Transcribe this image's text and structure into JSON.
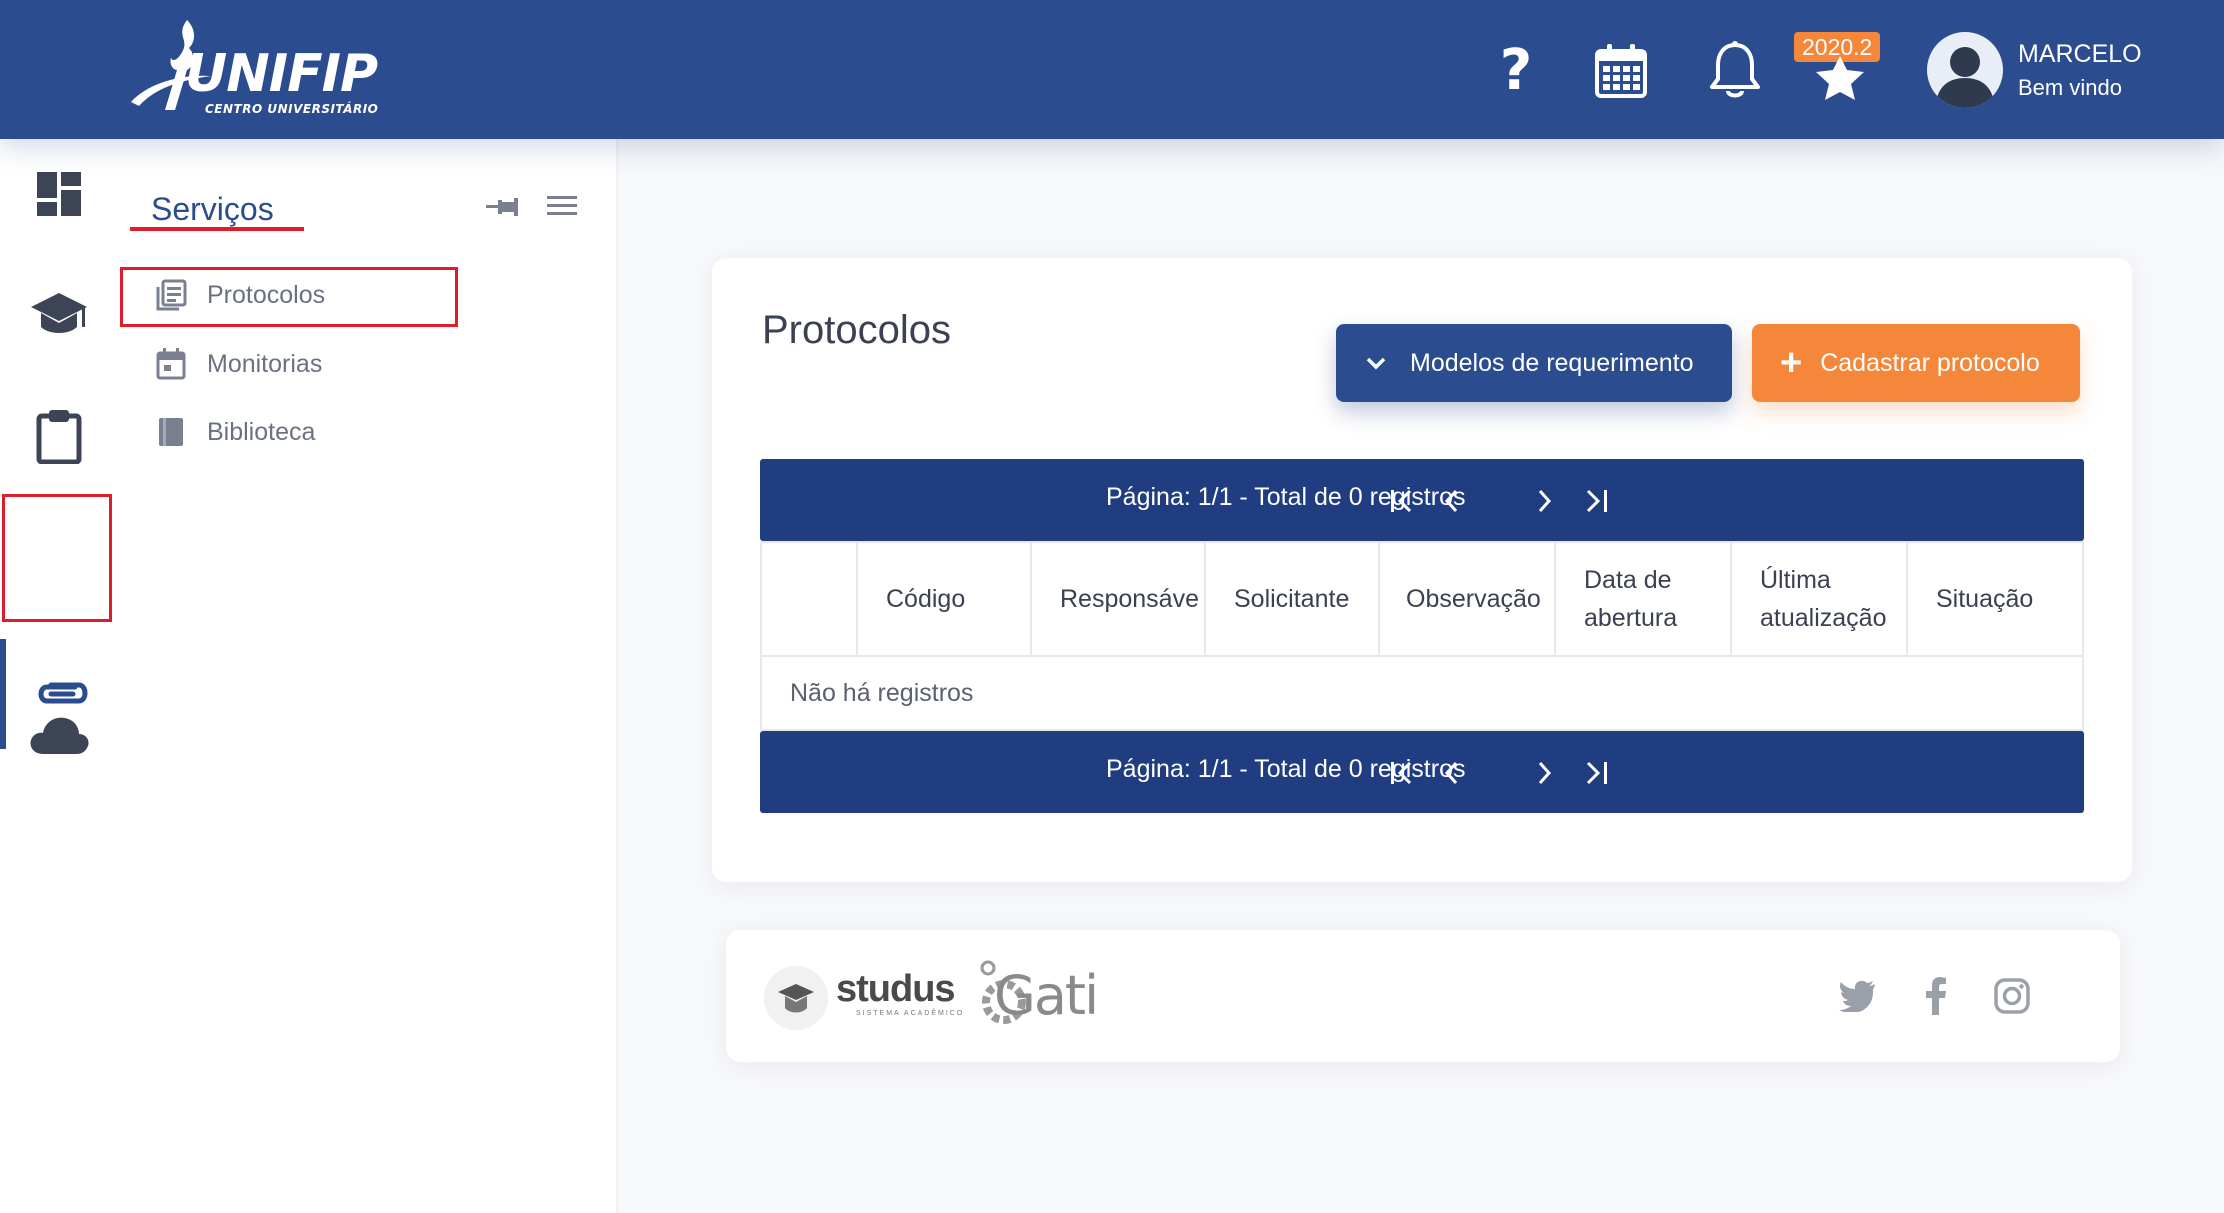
{
  "header": {
    "logo_text": "UNIFIP",
    "logo_subtitle": "CENTRO UNIVERSITÁRIO",
    "help_symbol": "?",
    "semester_badge": "2020.2",
    "user_name": "MARCELO",
    "user_greeting": "Bem vindo",
    "icons": [
      "help-icon",
      "calendar-icon",
      "bell-icon",
      "star-icon",
      "user-avatar"
    ]
  },
  "rail": {
    "items": [
      {
        "name": "dashboard-icon"
      },
      {
        "name": "graduation-cap-icon"
      },
      {
        "name": "clipboard-icon"
      },
      {
        "name": "paperclip-icon",
        "active": true
      },
      {
        "name": "cloud-icon"
      }
    ]
  },
  "submenu": {
    "title": "Serviços",
    "items": [
      {
        "label": "Protocolos",
        "icon": "document-list-icon"
      },
      {
        "label": "Monitorias",
        "icon": "calendar-small-icon"
      },
      {
        "label": "Biblioteca",
        "icon": "book-icon"
      }
    ]
  },
  "page": {
    "title": "Protocolos",
    "models_button": "Modelos de requerimento",
    "new_button": "Cadastrar protocolo",
    "new_button_symbol": "+",
    "pagination_text": "Página: 1/1 - Total de 0 registros",
    "table": {
      "columns": [
        "Código",
        "Responsáve",
        "Solicitante",
        "Observação",
        "Data de abertura",
        "Última atualização",
        "Situação"
      ],
      "empty_text": "Não há registros"
    }
  },
  "footer": {
    "studus_text": "studus",
    "studus_subtext": "SISTEMA ACADÊMICO",
    "gati_text": "Gati",
    "social": [
      "twitter-icon",
      "facebook-icon",
      "instagram-icon"
    ]
  },
  "colors": {
    "primary": "#2b4c8f",
    "pager": "#1f3d80",
    "accent": "#f5873a",
    "highlight": "#e01b2a"
  }
}
